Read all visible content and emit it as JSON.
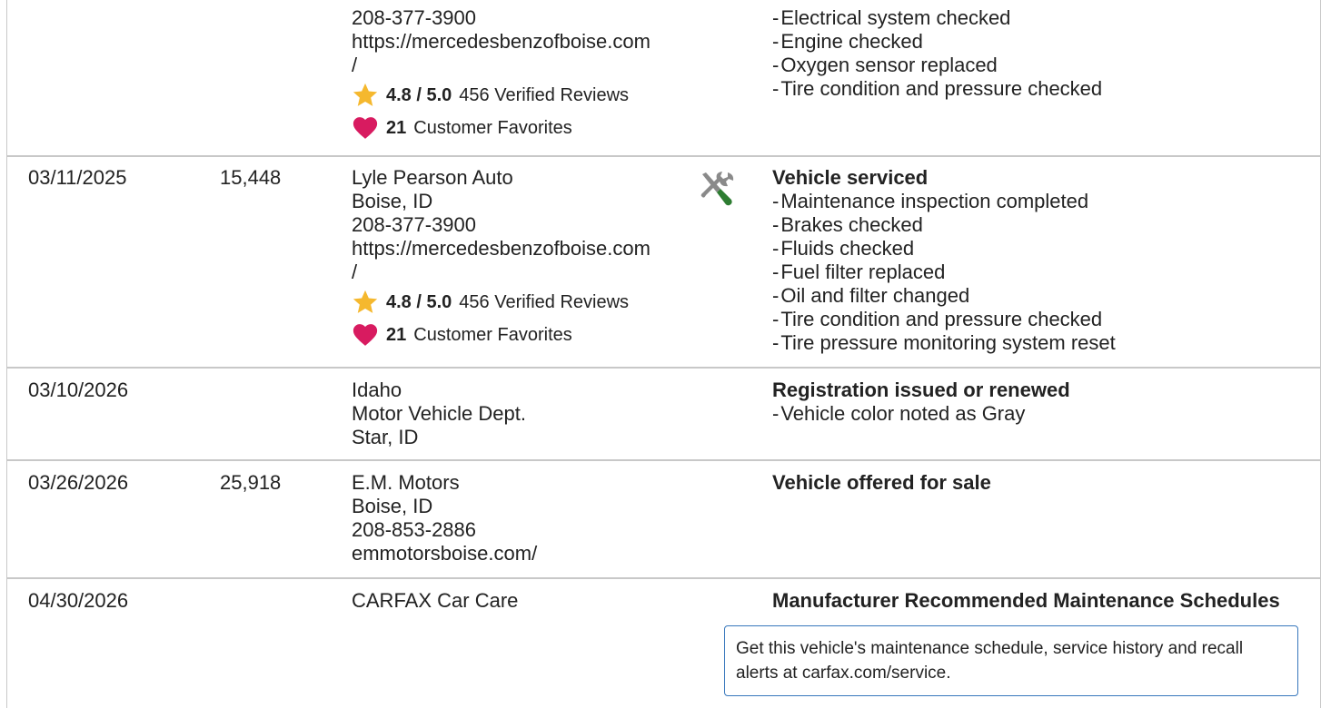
{
  "rows": [
    {
      "date": "",
      "mileage": "",
      "source": [
        "208-377-3900",
        "https://mercedesbenzofboise.com",
        "/"
      ],
      "rating": "4.8 / 5.0",
      "reviews": "456 Verified Reviews",
      "favorites_count": "21",
      "favorites_label": "Customer Favorites",
      "heading": "",
      "items": [
        "Electrical system checked",
        "Engine checked",
        "Oxygen sensor replaced",
        "Tire condition and pressure checked"
      ]
    },
    {
      "date": "03/11/2025",
      "mileage": "15,448",
      "source": [
        "Lyle Pearson Auto",
        "Boise, ID",
        "208-377-3900",
        "https://mercedesbenzofboise.com",
        "/"
      ],
      "rating": "4.8 / 5.0",
      "reviews": "456 Verified Reviews",
      "favorites_count": "21",
      "favorites_label": "Customer Favorites",
      "icon": "service-tools-icon",
      "heading": "Vehicle serviced",
      "items": [
        "Maintenance inspection completed",
        "Brakes checked",
        "Fluids checked",
        "Fuel filter replaced",
        "Oil and filter changed",
        "Tire condition and pressure checked",
        "Tire pressure monitoring system reset"
      ]
    },
    {
      "date": "03/10/2026",
      "mileage": "",
      "source": [
        "Idaho",
        "Motor Vehicle Dept.",
        "Star, ID"
      ],
      "heading": "Registration issued or renewed",
      "items": [
        "Vehicle color noted as Gray"
      ]
    },
    {
      "date": "03/26/2026",
      "mileage": "25,918",
      "source": [
        "E.M. Motors",
        "Boise, ID",
        "208-853-2886",
        "emmotorsboise.com/"
      ],
      "heading": "Vehicle offered for sale",
      "items": []
    },
    {
      "date": "04/30/2026",
      "mileage": "",
      "source": [
        "CARFAX Car Care"
      ],
      "heading": "Manufacturer Recommended Maintenance Schedules",
      "items": [],
      "callout": "Get this vehicle's maintenance schedule, service history and recall alerts at carfax.com/service."
    }
  ],
  "colors": {
    "border": "#c8c8c8",
    "star": "#f5b82e",
    "heart": "#d81b60",
    "callout_border": "#3777bc",
    "wrench_green": "#2e7d32",
    "tool_gray": "#8a8a8a"
  }
}
